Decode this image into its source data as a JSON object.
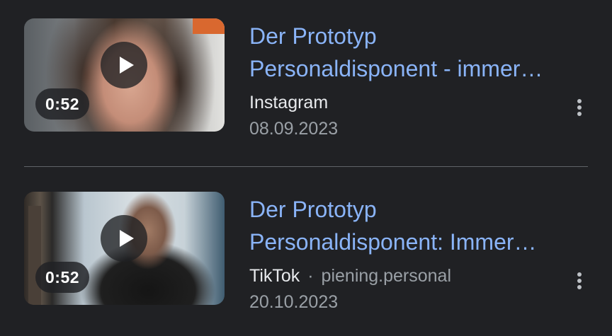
{
  "results": [
    {
      "title_line1": "Der Prototyp",
      "title_line2": "Personaldisponent - immer…",
      "duration": "0:52",
      "source": "Instagram",
      "author": "",
      "date": "08.09.2023"
    },
    {
      "title_line1": "Der Prototyp",
      "title_line2": "Personaldisponent: Immer…",
      "duration": "0:52",
      "source": "TikTok",
      "separator": "·",
      "author": "piening.personal",
      "date": "20.10.2023"
    }
  ],
  "colors": {
    "background": "#202124",
    "title_link": "#8ab4f8",
    "primary_text": "#e8eaed",
    "secondary_text": "#9aa0a6"
  },
  "icons": {
    "play": "play-icon",
    "more": "more-vert-icon"
  }
}
